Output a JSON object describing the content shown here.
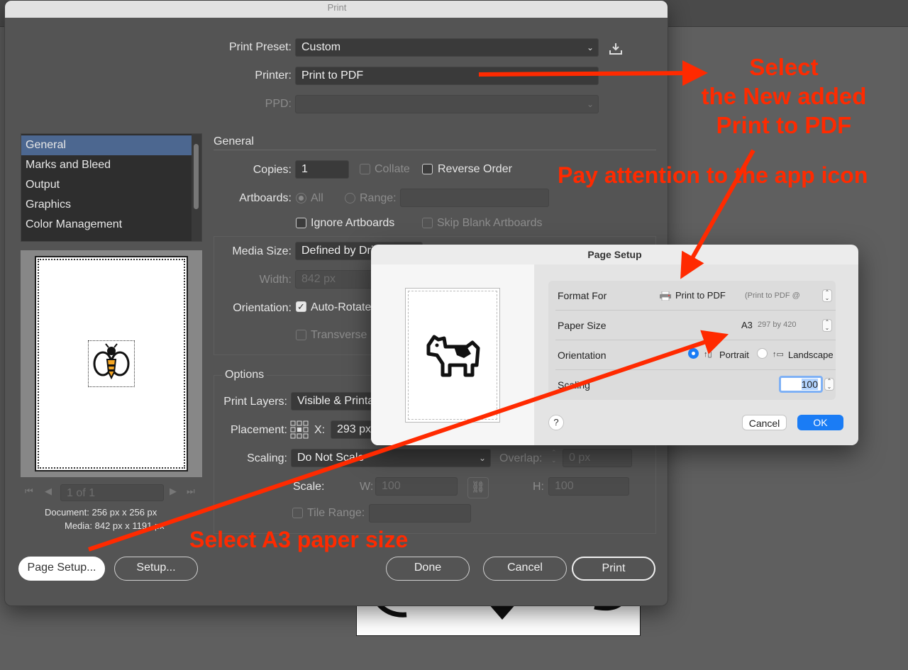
{
  "window": {
    "title": "Print"
  },
  "header": {
    "print_preset_label": "Print Preset:",
    "print_preset_value": "Custom",
    "printer_label": "Printer:",
    "printer_value": "Print to PDF",
    "ppd_label": "PPD:"
  },
  "sidebar": {
    "items": [
      {
        "label": "General",
        "selected": true
      },
      {
        "label": "Marks and Bleed",
        "selected": false
      },
      {
        "label": "Output",
        "selected": false
      },
      {
        "label": "Graphics",
        "selected": false
      },
      {
        "label": "Color Management",
        "selected": false
      }
    ]
  },
  "preview": {
    "pager": "1 of 1",
    "document_info": "Document: 256 px x 256 px",
    "media_info": "Media: 842 px x 1191 px"
  },
  "general": {
    "heading": "General",
    "copies_label": "Copies:",
    "copies_value": "1",
    "collate_label": "Collate",
    "reverse_order_label": "Reverse Order",
    "artboards_label": "Artboards:",
    "all_label": "All",
    "range_label": "Range:",
    "ignore_artboards_label": "Ignore Artboards",
    "skip_blank_label": "Skip Blank Artboards",
    "media_size_label": "Media Size:",
    "media_size_value": "Defined by Driver",
    "width_label": "Width:",
    "width_value": "842 px",
    "orientation_label": "Orientation:",
    "auto_rotate_label": "Auto-Rotate",
    "transverse_label": "Transverse"
  },
  "options": {
    "heading": "Options",
    "print_layers_label": "Print Layers:",
    "print_layers_value": "Visible & Printable Layers",
    "placement_label": "Placement:",
    "x_label": "X:",
    "x_value": "293 px",
    "scaling_label": "Scaling:",
    "scaling_value": "Do Not Scale",
    "overlap_label": "Overlap:",
    "overlap_value": "0 px",
    "scale_label": "Scale:",
    "w_label": "W:",
    "w_value": "100",
    "h_label": "H:",
    "h_value": "100",
    "tile_range_label": "Tile Range:"
  },
  "footer": {
    "page_setup": "Page Setup...",
    "setup": "Setup...",
    "done": "Done",
    "cancel": "Cancel",
    "print": "Print"
  },
  "page_setup_sheet": {
    "title": "Page Setup",
    "format_for_label": "Format For",
    "format_for_value": "Print to PDF",
    "format_for_detail": "(Print to PDF @",
    "paper_size_label": "Paper Size",
    "paper_size_value": "A3",
    "paper_size_detail": "297 by 420",
    "orientation_label": "Orientation",
    "portrait_label": "Portrait",
    "landscape_label": "Landscape",
    "scaling_label": "Scaling",
    "scaling_value": "100",
    "help": "?",
    "cancel": "Cancel",
    "ok": "OK"
  },
  "annotations": {
    "select_printer_line1": "Select",
    "select_printer_line2": "the New added",
    "select_printer_line3": "Print to PDF",
    "app_icon": "Pay attention to the app icon",
    "a3": "Select A3 paper size"
  },
  "colors": {
    "annotation": "#ff2a00",
    "selection": "#4c6790",
    "ok_button": "#1a7cf5"
  }
}
